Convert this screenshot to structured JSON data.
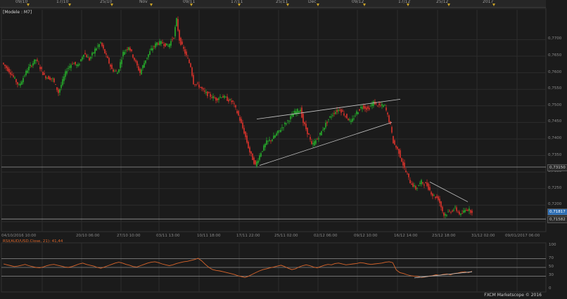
{
  "header": {
    "dates": [
      "09/10",
      "17/10",
      "25/10",
      "Nov",
      "09/11",
      "17/11",
      "25/11",
      "Dec",
      "09/12",
      "17/12",
      "25/12",
      "2017"
    ],
    "panel_title": "[Modele : M7]"
  },
  "colors": {
    "background": "#1b1b1b",
    "grid": "#2c2c2c",
    "up_candle": "#25a02a",
    "down_candle": "#c8302a",
    "trendline": "#c8c8c8",
    "rsi_line": "#d9652b",
    "tag_blue": "#2f6fb5",
    "event_marker": "#c9a227"
  },
  "chart_data": [
    {
      "type": "candlestick",
      "symbol": "AUD/USD",
      "ylim": [
        0.712,
        0.779
      ],
      "y_ticks": [
        "0,7700",
        "0,7650",
        "0,7600",
        "0,7550",
        "0,7500",
        "0,7450",
        "0,7400",
        "0,7350",
        "0,7300",
        "0,7250",
        "0,7200",
        "0,7150"
      ],
      "price_tags": {
        "level_line": "0,73150",
        "last_price": "0,71817",
        "lower_level": "0,71582"
      },
      "x_tick_labels": [
        "04/10/2016 10:00",
        "20/10 06:00",
        "27/10 10:00",
        "03/11 13:00",
        "10/11 18:00",
        "17/11 22:00",
        "25/11 02:00",
        "02/12 06:00",
        "09/12 10:00",
        "16/12 14:00",
        "23/12 18:00",
        "31/12 02:00",
        "09/01/2017 06:00"
      ],
      "path_points": [
        [
          0,
          0.763
        ],
        [
          6,
          0.76
        ],
        [
          12,
          0.756
        ],
        [
          18,
          0.761
        ],
        [
          24,
          0.764
        ],
        [
          30,
          0.759
        ],
        [
          36,
          0.758
        ],
        [
          40,
          0.754
        ],
        [
          46,
          0.761
        ],
        [
          50,
          0.763
        ],
        [
          54,
          0.762
        ],
        [
          58,
          0.766
        ],
        [
          62,
          0.764
        ],
        [
          66,
          0.767
        ],
        [
          70,
          0.769
        ],
        [
          74,
          0.765
        ],
        [
          78,
          0.761
        ],
        [
          82,
          0.76
        ],
        [
          86,
          0.766
        ],
        [
          90,
          0.768
        ],
        [
          94,
          0.764
        ],
        [
          98,
          0.76
        ],
        [
          102,
          0.764
        ],
        [
          106,
          0.767
        ],
        [
          110,
          0.769
        ],
        [
          114,
          0.769
        ],
        [
          118,
          0.768
        ],
        [
          122,
          0.771
        ],
        [
          124,
          0.776
        ],
        [
          126,
          0.77
        ],
        [
          130,
          0.766
        ],
        [
          134,
          0.762
        ],
        [
          136,
          0.757
        ],
        [
          140,
          0.756
        ],
        [
          144,
          0.754
        ],
        [
          148,
          0.753
        ],
        [
          152,
          0.752
        ],
        [
          156,
          0.753
        ],
        [
          160,
          0.752
        ],
        [
          164,
          0.751
        ],
        [
          168,
          0.747
        ],
        [
          172,
          0.742
        ],
        [
          176,
          0.736
        ],
        [
          180,
          0.732
        ],
        [
          184,
          0.736
        ],
        [
          188,
          0.739
        ],
        [
          192,
          0.74
        ],
        [
          196,
          0.742
        ],
        [
          200,
          0.744
        ],
        [
          204,
          0.746
        ],
        [
          208,
          0.748
        ],
        [
          212,
          0.749
        ],
        [
          214,
          0.745
        ],
        [
          218,
          0.741
        ],
        [
          220,
          0.738
        ],
        [
          224,
          0.74
        ],
        [
          228,
          0.743
        ],
        [
          232,
          0.746
        ],
        [
          236,
          0.748
        ],
        [
          240,
          0.749
        ],
        [
          244,
          0.747
        ],
        [
          248,
          0.745
        ],
        [
          252,
          0.748
        ],
        [
          256,
          0.75
        ],
        [
          260,
          0.749
        ],
        [
          264,
          0.751
        ],
        [
          268,
          0.75
        ],
        [
          272,
          0.75
        ],
        [
          276,
          0.744
        ],
        [
          278,
          0.739
        ],
        [
          282,
          0.736
        ],
        [
          286,
          0.731
        ],
        [
          290,
          0.727
        ],
        [
          294,
          0.725
        ],
        [
          298,
          0.727
        ],
        [
          302,
          0.726
        ],
        [
          306,
          0.723
        ],
        [
          310,
          0.722
        ],
        [
          314,
          0.717
        ],
        [
          318,
          0.718
        ],
        [
          322,
          0.719
        ],
        [
          326,
          0.717
        ],
        [
          330,
          0.719
        ],
        [
          333,
          0.7182
        ]
      ],
      "trendlines": [
        {
          "name": "upper wedge",
          "from": [
            180,
            0.746
          ],
          "to": [
            282,
            0.752
          ]
        },
        {
          "name": "lower wedge",
          "from": [
            182,
            0.732
          ],
          "to": [
            276,
            0.745
          ]
        },
        {
          "name": "descending top",
          "from": [
            303,
            0.727
          ],
          "to": [
            330,
            0.721
          ]
        }
      ],
      "horizontal_levels": [
        0.7315,
        0.7158
      ]
    },
    {
      "type": "line",
      "title": "RSI(AUD/USD.Close, 21): 41,44",
      "ylim": [
        0,
        100
      ],
      "y_ticks": [
        "100",
        "70",
        "50",
        "30",
        "0"
      ],
      "reference_levels": [
        70,
        50,
        30
      ],
      "last_value": 41.44,
      "trendline": {
        "from": [
          292,
          26
        ],
        "to": [
          333,
          40
        ]
      },
      "values": [
        58,
        56,
        54,
        52,
        53,
        55,
        57,
        54,
        52,
        50,
        49,
        51,
        54,
        56,
        57,
        55,
        53,
        51,
        50,
        52,
        55,
        58,
        60,
        57,
        55,
        53,
        50,
        48,
        51,
        54,
        57,
        60,
        62,
        60,
        57,
        55,
        52,
        51,
        54,
        57,
        60,
        62,
        63,
        61,
        58,
        56,
        54,
        56,
        59,
        61,
        63,
        64,
        66,
        68,
        71,
        65,
        57,
        50,
        45,
        43,
        42,
        40,
        38,
        36,
        34,
        31,
        29,
        27,
        30,
        34,
        38,
        42,
        45,
        47,
        49,
        51,
        53,
        55,
        52,
        48,
        45,
        47,
        51,
        54,
        56,
        54,
        51,
        49,
        52,
        55,
        57,
        56,
        59,
        60,
        58,
        56,
        57,
        58,
        59,
        61,
        60,
        58,
        57,
        58,
        59,
        60,
        62,
        63,
        61,
        44,
        38,
        36,
        33,
        31,
        30,
        29,
        27,
        28,
        30,
        31,
        33,
        32,
        34,
        35,
        33,
        36,
        37,
        39,
        40,
        38,
        41
      ]
    }
  ],
  "footer": {
    "credit": "FXCM Marketscope © 2016"
  }
}
